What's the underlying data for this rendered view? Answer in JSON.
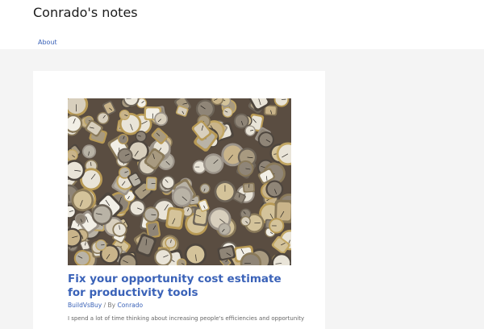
{
  "site": {
    "title": "Conrado's notes"
  },
  "nav": {
    "items": [
      {
        "label": "About"
      }
    ]
  },
  "post": {
    "title": "Fix your opportunity cost estimate for productivity tools",
    "category": "BuildVsBuy",
    "by_label": "/ By",
    "author": "Conrado",
    "excerpt": "I spend a lot of time thinking about increasing people's efficiencies and opportunity"
  },
  "colors": {
    "link": "#3a62b8",
    "page_bg": "#f4f4f4",
    "card_bg": "#ffffff"
  }
}
